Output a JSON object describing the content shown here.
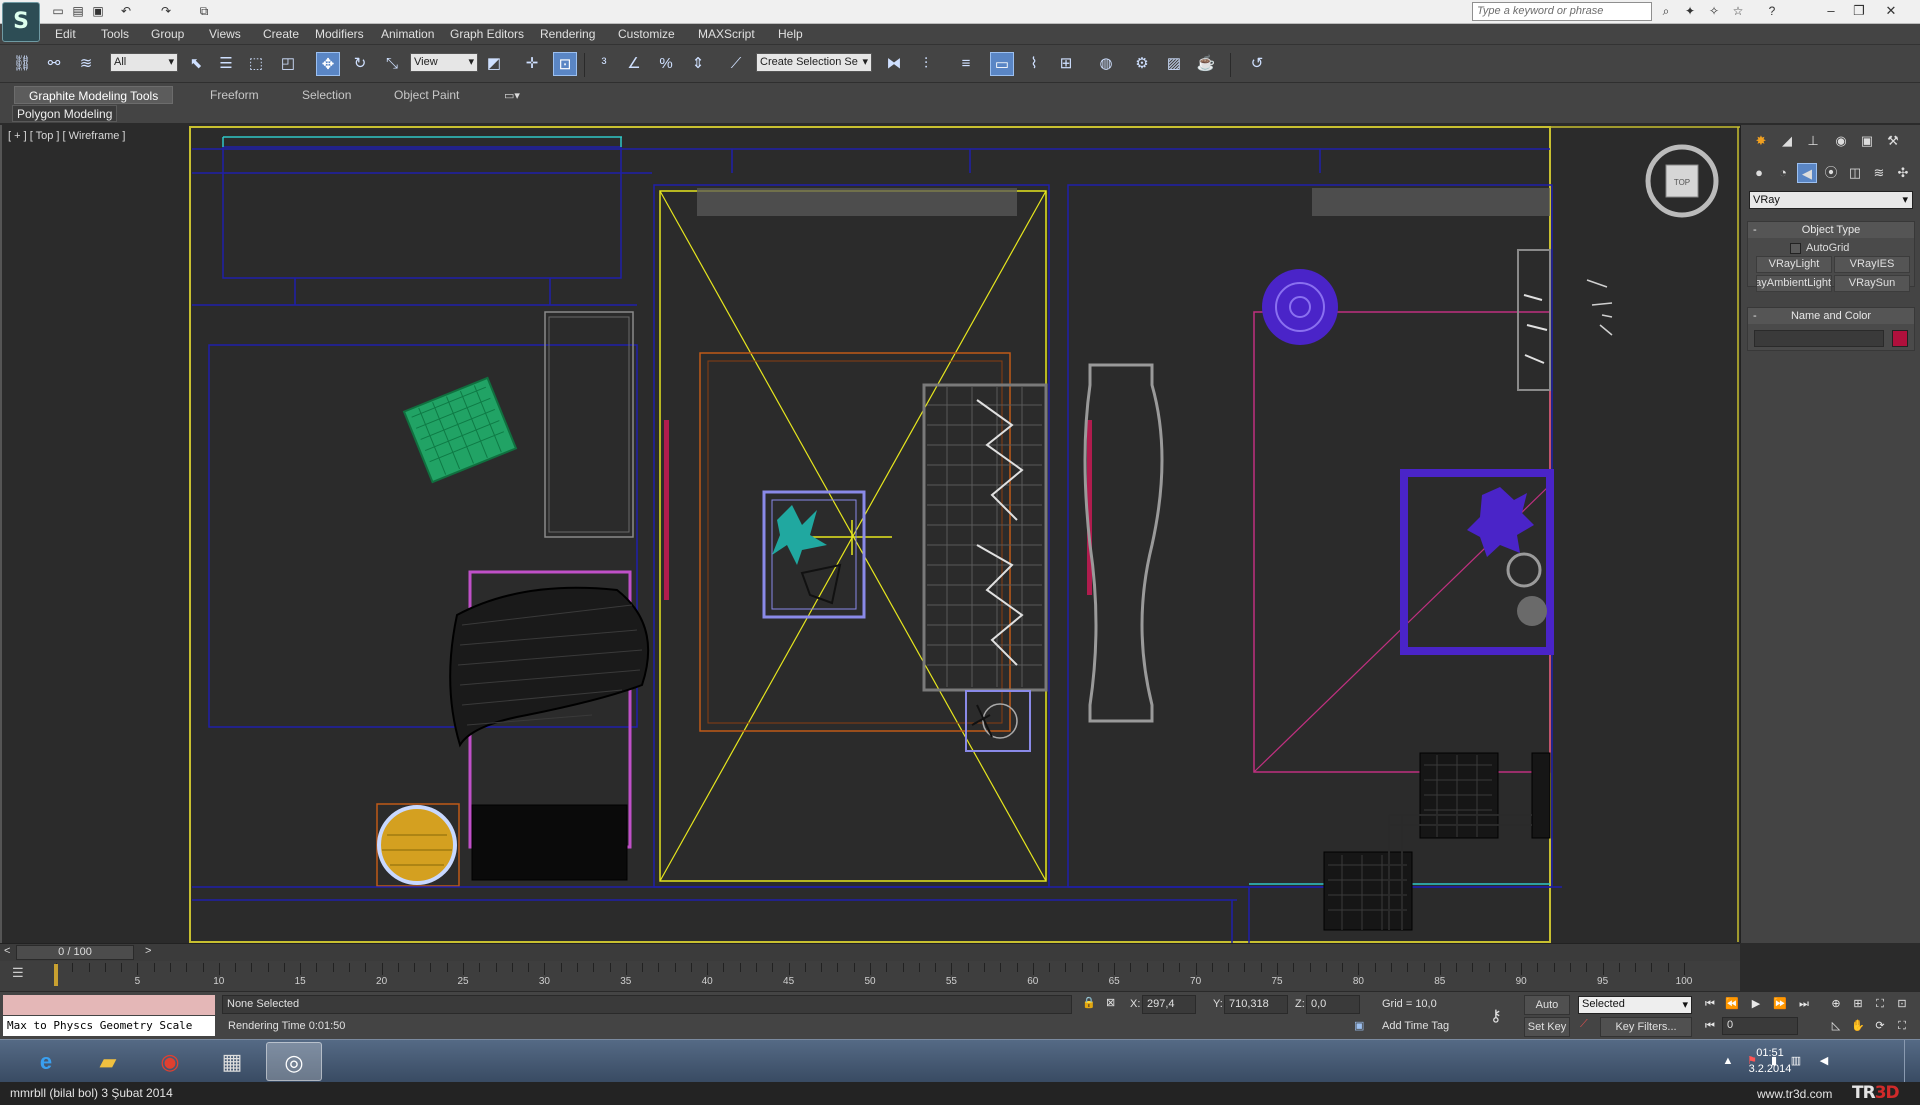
{
  "titlebar": {
    "search_placeholder": "Type a keyword or phrase",
    "quick_access_icons": [
      "new-file-icon",
      "open-folder-icon",
      "save-icon",
      "undo-icon",
      "redo-icon",
      "hold-icon"
    ],
    "window_buttons": [
      "minimize-icon",
      "restore-icon",
      "close-icon"
    ]
  },
  "menu": [
    "Edit",
    "Tools",
    "Group",
    "Views",
    "Create",
    "Modifiers",
    "Animation",
    "Graph Editors",
    "Rendering",
    "Customize",
    "MAXScript",
    "Help"
  ],
  "toolbar": {
    "selection_filter": "All",
    "reference_coord": "View",
    "named_selection": "Create Selection Se"
  },
  "ribbon": {
    "tabs": [
      "Graphite Modeling Tools",
      "Freeform",
      "Selection",
      "Object Paint"
    ],
    "active_tab": 0,
    "sub_panel": "Polygon Modeling"
  },
  "viewport": {
    "label": "[ + ] [ Top ] [ Wireframe ]",
    "viewcube_label": "TOP",
    "colors": {
      "frame": "#c8c030",
      "walls": "#1f1faa",
      "camera": "#e6e61e",
      "magenta": "#c03080",
      "cyan": "#30c8c8",
      "green": "#20b870",
      "purple": "#4a24c8",
      "orange": "#c05a18"
    }
  },
  "command_panel": {
    "renderer": "VRay",
    "object_type": {
      "title": "Object Type",
      "autogrid": "AutoGrid",
      "buttons": [
        "VRayLight",
        "VRayIES",
        "VRayAmbientLight",
        "VRaySun"
      ]
    },
    "name_color": {
      "title": "Name and Color",
      "name_value": "",
      "swatch_color": "#b0103c"
    }
  },
  "timeline": {
    "slider_label": "0 / 100",
    "ticks": [
      5,
      10,
      15,
      20,
      25,
      30,
      35,
      40,
      45,
      50,
      55,
      60,
      65,
      70,
      75,
      80,
      85,
      90,
      95,
      100
    ]
  },
  "status": {
    "maxscript_output": "Max to Physcs Geometry Scale",
    "selection": "None Selected",
    "prompt": "Rendering Time  0:01:50",
    "x_label": "X:",
    "x_value": "297,4",
    "y_label": "Y:",
    "y_value": "710,318",
    "z_label": "Z:",
    "z_value": "0,0",
    "grid": "Grid = 10,0",
    "add_time_tag": "Add Time Tag",
    "auto_key": "Auto Key",
    "auto_key_mode": "Selected",
    "set_key": "Set Key",
    "key_filters": "Key Filters...",
    "frame": "0"
  },
  "taskbar": {
    "apps": [
      "internet-explorer-icon",
      "file-explorer-icon",
      "chrome-icon",
      "remote-desktop-icon",
      "3dsmax-icon"
    ],
    "time": "01:51",
    "date": "3.2.2014"
  },
  "caption": {
    "left": "mmrbll (bilal bol)  3 Şubat 2014",
    "site": "www.tr3d.com",
    "logo": "TR3D"
  }
}
